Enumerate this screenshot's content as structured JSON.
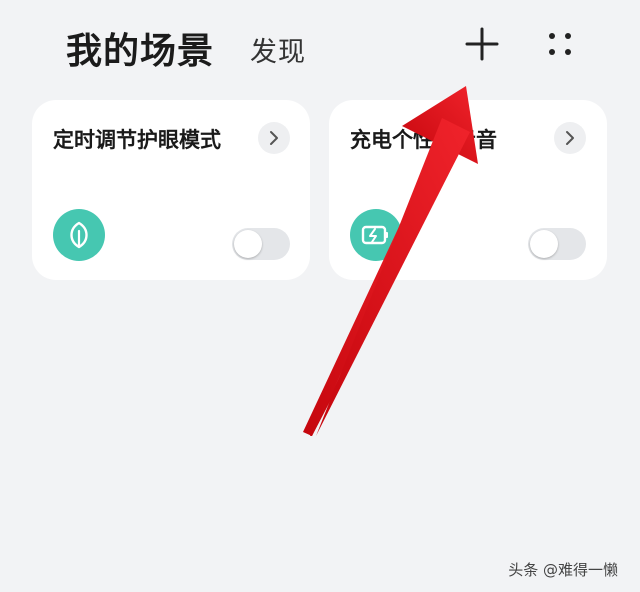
{
  "header": {
    "active_tab": "我的场景",
    "inactive_tab": "发现",
    "add_icon": "plus-icon",
    "more_icon": "grid-dots-icon"
  },
  "cards": [
    {
      "title": "定时调节护眼模式",
      "icon": "leaf-icon",
      "toggle_on": false
    },
    {
      "title": "充电个性提示音",
      "icon": "battery-charging-icon",
      "toggle_on": false
    }
  ],
  "colors": {
    "background": "#f2f3f5",
    "card": "#ffffff",
    "accent": "#46c7b1",
    "arrow": "#e8141c"
  },
  "watermark": "头条 @难得一懒"
}
